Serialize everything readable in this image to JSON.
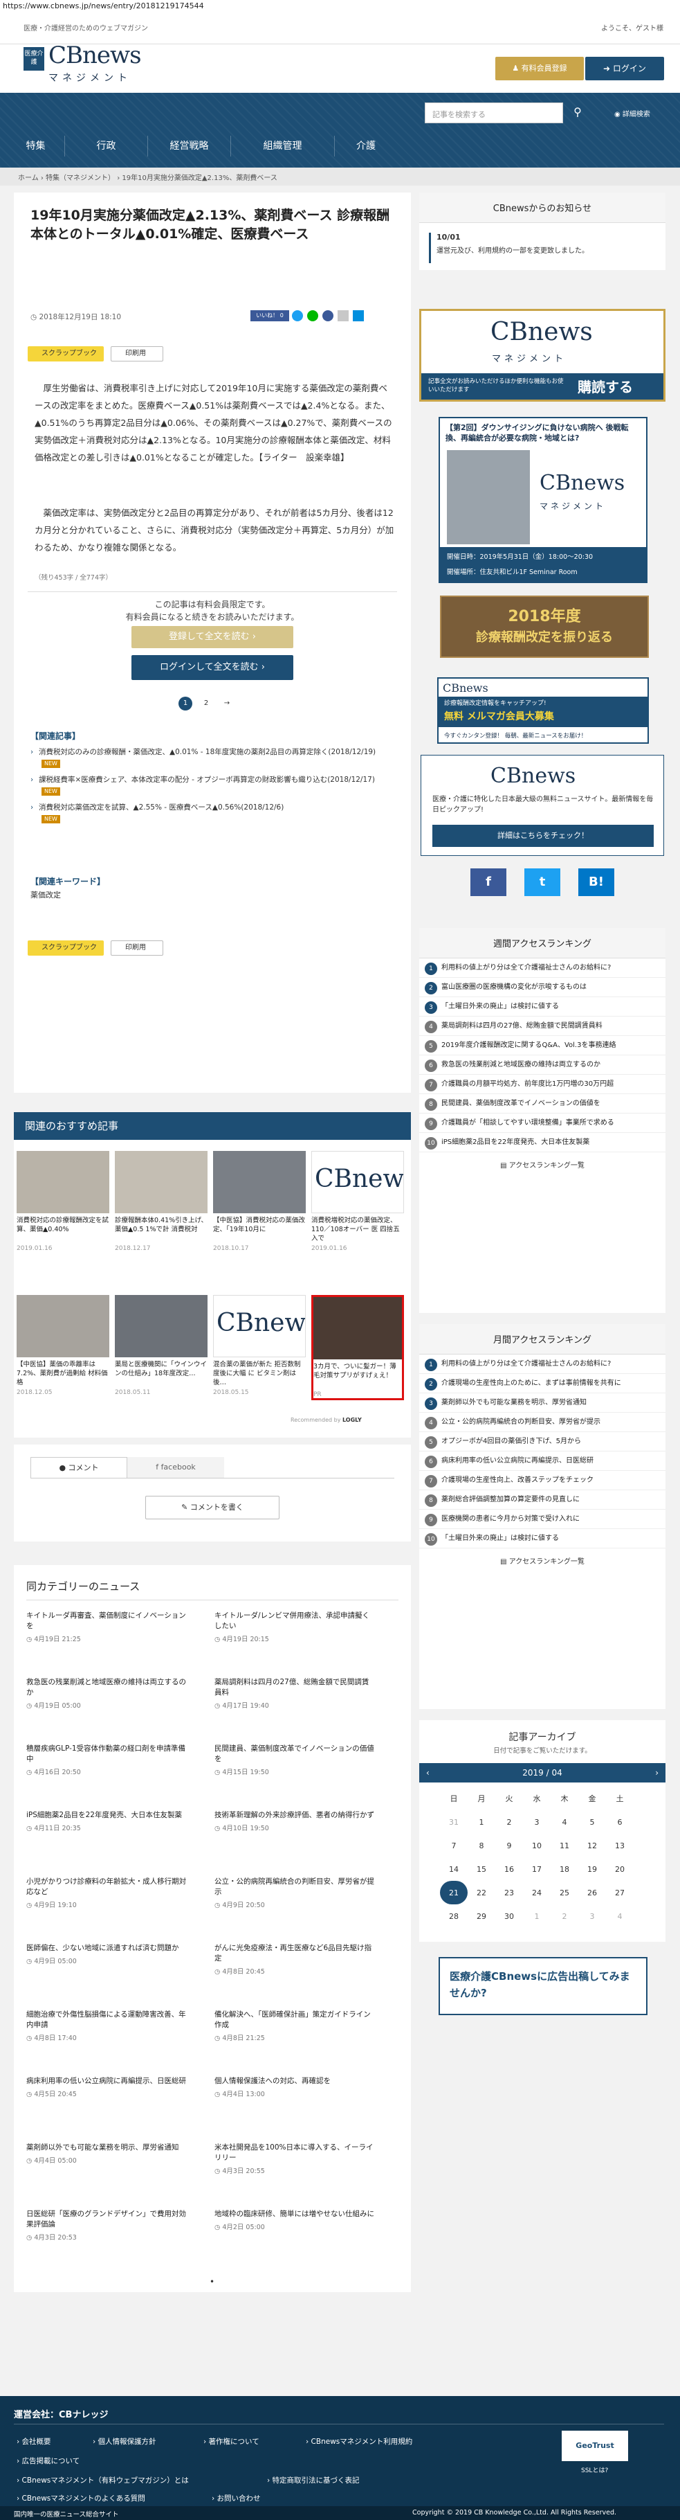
{
  "url": "https://www.cbnews.jp/news/entry/20181219174544",
  "header": {
    "tagline": "医療・介護経営のためのウェブマガジン",
    "welcome": "ようこそ、ゲスト様",
    "logo_badge": "医療介護",
    "logo_name": "CBnews",
    "logo_sub": "マネジメント",
    "pay_btn": "有料会員登録",
    "login_btn": "ログイン"
  },
  "search": {
    "placeholder": "記事を検索する",
    "advanced": "詳細検索"
  },
  "nav": [
    "特集",
    "行政",
    "経営戦略",
    "組織管理",
    "介護"
  ],
  "breadcrumb": "ホーム  ›  特集（マネジメント）  ›  19年10月実施分薬価改定▲2.13%、薬剤費ベース",
  "article": {
    "title": "19年10月実施分薬価改定▲2.13%、薬剤費ベース 診療報酬本体とのトータル▲0.01%確定、医療費ベース",
    "date": "2018年12月19日 18:10",
    "scrap": "スクラップブック",
    "print": "印刷用",
    "p1": "厚生労働省は、消費税率引き上げに対応して2019年10月に実施する薬価改定の薬剤費ベースの改定率をまとめた。医療費ベース▲0.51%は薬剤費ベースでは▲2.4%となる。また、▲0.51%のうち再算定2品目分は▲0.06%、その薬剤費ベースは▲0.27%で、薬剤費ベースの実勢価改定＋消費税対応分は▲2.13%となる。10月実施分の診療報酬本体と薬価改定、材料価格改定との差し引きは▲0.01%となることが確定した。【ライター　設楽幸雄】",
    "p2": "薬価改定率は、実勢価改定分と2品目の再算定分があり、それが前者は5カ月分、後者は12カ月分と分かれていること、さらに、消費税対応分（実勢価改定分＋再算定、5カ月分）が加わるため、かなり複雑な関係となる。",
    "remain": "（残り453字 / 全774字）",
    "paywall1": "この記事は有料会員限定です。",
    "paywall2": "有料会員になると続きをお読みいただけます。",
    "reg_btn": "登録して全文を読む ›",
    "login_btn": "ログインして全文を読む ›",
    "pages": [
      "1",
      "2",
      "→"
    ],
    "related_head": "【関連記事】",
    "related": [
      {
        "t": "消費税対応のみの診療報酬・薬価改定、▲0.01% - 18年度実施の薬剤2品目の再算定除く(2018/12/19)",
        "new": "NEW"
      },
      {
        "t": "課税経費率×医療費シェア、本体改定率の配分 - オプジーボ再算定の財政影響も織り込む(2018/12/17)",
        "new": "NEW"
      },
      {
        "t": "消費税対応薬価改定を試算、▲2.55% - 医療費ベース▲0.56%(2018/12/6)",
        "new": "NEW"
      }
    ],
    "keyword_head": "【関連キーワード】",
    "keyword": "薬価改定",
    "social": {
      "like": "いいね！ 0",
      "tweet": "ツイート"
    }
  },
  "recommend": {
    "title": "関連のおすすめ記事",
    "items": [
      {
        "cap": "消費税対応の診療報酬改定を試算、薬価▲0.40%",
        "date": "2019.01.16"
      },
      {
        "cap": "診療報酬本体0.41%引き上げ、薬価▲0.5 1%で計 消費税対",
        "date": "2018.12.17"
      },
      {
        "cap": "【中医協】消費税対応の薬価改定、「19年10月に",
        "date": "2018.10.17"
      },
      {
        "cap": "消費税増税対応の薬価改定、110／108オーバー 医 四捨五入で",
        "date": "2019.01.16"
      },
      {
        "cap": "【中医協】薬価の乖離率は7.2%、薬剤費が過剰給 材料価格",
        "date": "2018.12.05"
      },
      {
        "cap": "薬局と医療機関に「ウインウインの仕組み」18年度改定…",
        "date": "2018.05.11"
      },
      {
        "cap": "混合薬の薬価が新た 拒否数制度後に大幅 に ビタミン剤は後…",
        "date": "2018.05.15"
      },
      {
        "cap": "3カ月で、ついに髪ガー！薄毛対策サプリがすげぇえ！",
        "date": "PR"
      }
    ],
    "by": "Recommended by",
    "logly": "LOGLY"
  },
  "comments": {
    "tab1": "コメント",
    "tab2": "facebook",
    "write": "コメントを書く"
  },
  "samecat": {
    "title": "同カテゴリーのニュース",
    "items": [
      {
        "t": "キイトルーダ再審査、薬価制度にイノベーションを",
        "d": "4月19日 21:25"
      },
      {
        "t": "キイトルーダ/レンビマ併用療法、承認申請擬くしたい",
        "d": "4月19日 20:15"
      },
      {
        "t": "救急医の残業削減と地域医療の維持は両立するのか",
        "d": "4月19日 05:00"
      },
      {
        "t": "薬局調剤料は四月の27億、総賄金額で民間調賃員料",
        "d": "4月17日 19:40"
      },
      {
        "t": "積層疾病GLP-1受容体作動薬の経口剤を申請準備中",
        "d": "4月16日 20:50"
      },
      {
        "t": "民間建員、薬価制度改革でイノベーションの価値を",
        "d": "4月15日 19:50"
      },
      {
        "t": "iPS細胞薬2品目を22年度発売、大日本住友製薬",
        "d": "4月11日 20:35"
      },
      {
        "t": "技術革新理解の外来診療評価、悪者の納得行かず",
        "d": "4月10日 19:50"
      },
      {
        "t": "小児がかりつけ診療料の年齢拡大・成人移行期対応など",
        "d": "4月9日 19:10"
      },
      {
        "t": "公立・公的病院再編統合の判断目安、厚労省が提示",
        "d": "4月9日 20:50"
      },
      {
        "t": "医師偏在、少ない地域に派遣すれば済む問題か",
        "d": "4月9日 05:00"
      },
      {
        "t": "がんに光免疫療法・再生医療など6品目先駆け指定",
        "d": "4月8日 20:45"
      },
      {
        "t": "細胞治療で外傷性脳損傷による運動障害改善、年内申請",
        "d": "4月8日 17:40"
      },
      {
        "t": "備化解決へ、「医師確保計画」策定ガイドライン作成",
        "d": "4月8日 21:25"
      },
      {
        "t": "病床利用率の低い公立病院に再編提示、日医総研",
        "d": "4月5日 20:45"
      },
      {
        "t": "個人情報保護法への対応、再確認を",
        "d": "4月4日 13:00"
      },
      {
        "t": "薬剤師以外でも可能な業務を明示、厚労省通知",
        "d": "4月4日 05:00"
      },
      {
        "t": "米本社開発品を100%日本に導入する、イーライリリー",
        "d": "4月3日 20:55"
      },
      {
        "t": "日医総研「医療のグランドデザイン」で費用対効果評価論",
        "d": "4月3日 20:53"
      },
      {
        "t": "地域枠の臨床研修、簡単には増やせない仕組みに",
        "d": "4月2日 05:00"
      }
    ]
  },
  "sidebar": {
    "notice_title": "CBnewsからのお知らせ",
    "notice_date": "10/01",
    "notice_text": "運営元及び、利用規約の一部を変更致しました。",
    "ad1_name": "CBnews",
    "ad1_sub": "マネジメント",
    "ad1_text": "記事全文がお読みいただけるほか便利な機能もお使いいただけます",
    "ad1_btn": "購読する",
    "seminar_title": "【第2回】ダウンサイジングに負けない病院へ 後戦転換、再編統合が必要な病院・地域とは?",
    "seminar_date": "開催日時：2019年5月31日（金）18:00〜20:30",
    "seminar_place": "開催場所：住友共和ビル1F Seminar Room",
    "banner_year": "2018年度",
    "banner_text": "診療報酬改定を振り返る",
    "mail_head": "診療報酬改定情報をキャッチアップ!",
    "mail_main": "無料 メルマガ会員大募集",
    "mail_sub": "今すぐカンタン登録！ 毎朝、最新ニュースをお届け！",
    "cb2_name": "CBnews",
    "cb2_text": "医療・介護に特化した日本最大級の無料ニュースサイト。最新情報を毎日ピックアップ!",
    "cb2_btn": "詳細はこちらをチェック！",
    "weekly_title": "週間アクセスランキング",
    "weekly": [
      "利用料の値上がり分は全て介護福祉士さんのお給料に?",
      "富山医療圏の医療機構の変化が示唆するものは",
      "「土曜日外来の廃止」は検討に値する",
      "薬局調剤料は四月の27億、総賄金額で民間調賃員料",
      "2019年度介護報酬改定に関するQ&A、Vol.3を事務連絡",
      "救急医の残業削減と地域医療の維持は両立するのか",
      "介護職員の月額平均処方、前年度比1万円増の30万円超",
      "民間建員、薬価制度改革でイノベーションの価値を",
      "介護職員が「相談してやすい環境整備」事業所で求める",
      "iPS細胞薬2品目を22年度発売、大日本住友製薬"
    ],
    "monthly_title": "月間アクセスランキング",
    "monthly": [
      "利用料の値上がり分は全て介護福祉士さんのお給料に?",
      "介護現場の生産性向上のために、まずは事前情報を共有に",
      "薬剤師以外でも可能な業務を明示、厚労省通知",
      "公立・公的病院再編統合の判断目安、厚労省が提示",
      "オプジーボが4回目の薬価引き下げ、5月から",
      "病床利用率の低い公立病院に再編提示、日医総研",
      "介護現場の生産性向上、改善ステップをチェック",
      "薬剤総合評価調整加算の算定要件の見直しに",
      "医療機関の患者に今月から対策で受け入れに",
      "「土曜日外来の廃止」は検討に値する"
    ],
    "more": "アクセスランキング一覧",
    "archive_title": "記事アーカイブ",
    "archive_sub": "日付で記事をご覧いただけます。",
    "month": "2019 / 04",
    "weekdays": [
      "日",
      "月",
      "火",
      "水",
      "木",
      "金",
      "土"
    ],
    "cal": [
      [
        "31",
        "1",
        "2",
        "3",
        "4",
        "5",
        "6"
      ],
      [
        "7",
        "8",
        "9",
        "10",
        "11",
        "12",
        "13"
      ],
      [
        "14",
        "15",
        "16",
        "17",
        "18",
        "19",
        "20"
      ],
      [
        "21",
        "22",
        "23",
        "24",
        "25",
        "26",
        "27"
      ],
      [
        "28",
        "29",
        "30",
        "1",
        "2",
        "3",
        "4"
      ]
    ],
    "ad_text": "医療介護CBnewsに広告出稿してみませんか?"
  },
  "footer": {
    "company": "運営会社：CBナレッジ",
    "links": [
      "会社概要",
      "個人情報保護方針",
      "著作権について",
      "CBnewsマネジメント利用規約",
      "広告掲載について",
      "CBnewsマネジメント（有料ウェブマガジン）とは",
      "特定商取引法に基づく表記",
      "CBnewsマネジメントのよくある質問",
      "お問い合わせ"
    ],
    "bottom_left": "国内唯一の医療ニュース総合サイト",
    "copyright": "Copyright © 2019 CB Knowledge Co.,Ltd. All Rights Reserved.",
    "geotrust": "GeoTrust",
    "ssl": "SSLとは?"
  }
}
